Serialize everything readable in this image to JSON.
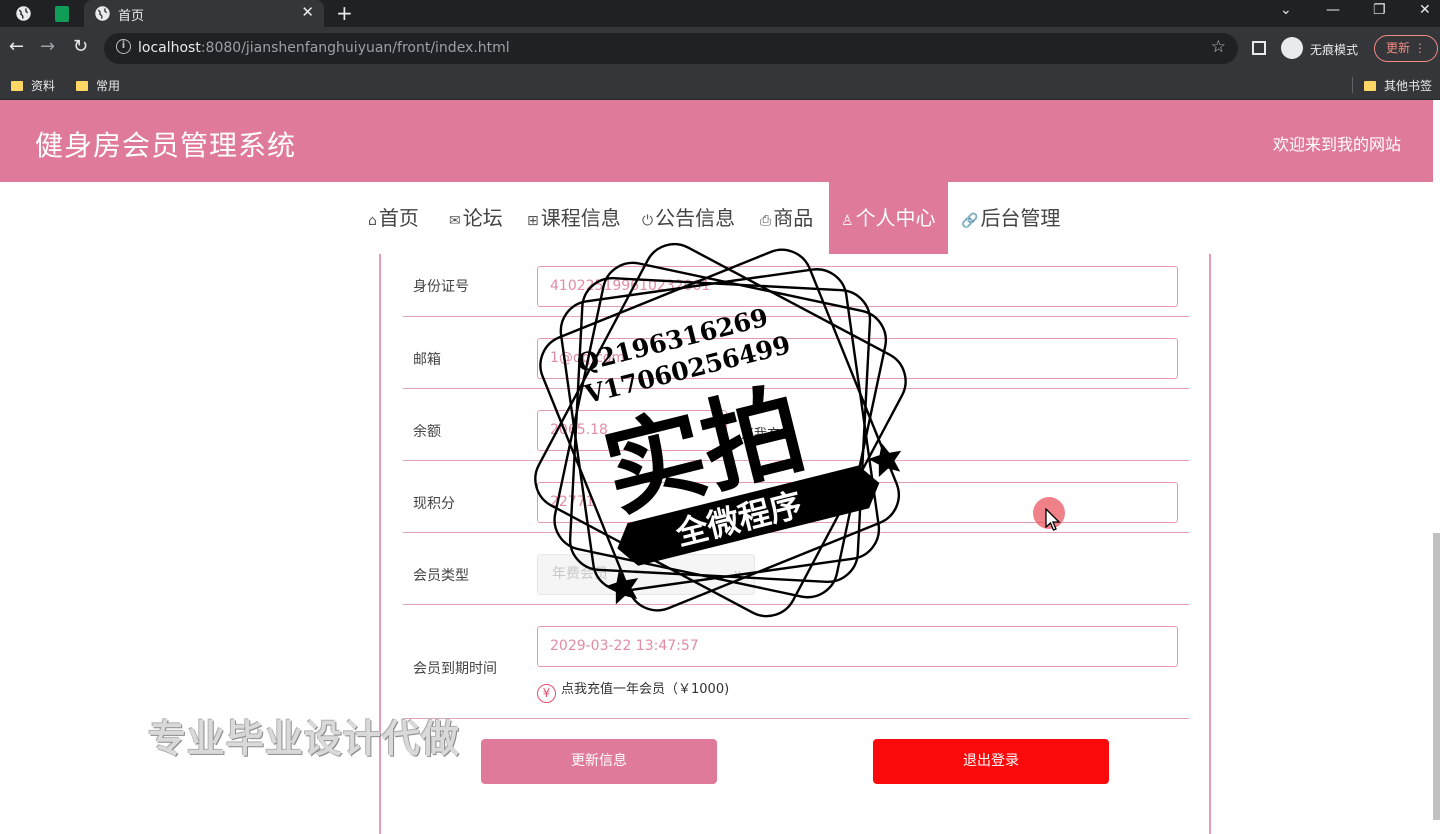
{
  "browser": {
    "tab_title": "首页",
    "url_host": "localhost",
    "url_rest": ":8080/jianshenfanghuiyuan/front/index.html",
    "incognito_label": "无痕模式",
    "update_label": "更新",
    "bookmarks": [
      "资料",
      "常用"
    ],
    "other_bookmarks": "其他书签"
  },
  "site": {
    "title": "健身房会员管理系统",
    "welcome": "欢迎来到我的网站",
    "accent_color": "#e07a9a"
  },
  "nav": {
    "items": [
      {
        "label": "首页",
        "icon": "home-icon"
      },
      {
        "label": "论坛",
        "icon": "mail-icon"
      },
      {
        "label": "课程信息",
        "icon": "gift-icon"
      },
      {
        "label": "公告信息",
        "icon": "power-icon"
      },
      {
        "label": "商品",
        "icon": "printer-icon"
      },
      {
        "label": "个人中心",
        "icon": "user-icon",
        "active": true
      },
      {
        "label": "后台管理",
        "icon": "link-icon"
      }
    ]
  },
  "form": {
    "id_card": {
      "label": "身份证号",
      "value": "410225199610232001"
    },
    "email": {
      "label": "邮箱",
      "value": "1@qq.com"
    },
    "balance": {
      "label": "余额",
      "value": "2065.18",
      "link": "点我充值"
    },
    "points": {
      "label": "现积分",
      "value": "22771"
    },
    "member_type": {
      "label": "会员类型",
      "value": "年费会员"
    },
    "expire": {
      "label": "会员到期时间",
      "value": "2029-03-22 13:47:57",
      "recharge_text": "点我充值一年会员（￥1000)"
    },
    "update_button": "更新信息",
    "logout_button": "退出登录",
    "logout_color": "#fa0a0a"
  },
  "watermark": {
    "stamp_line1": "Q2196316269",
    "stamp_line2": "V17060256499",
    "stamp_main": "实拍",
    "stamp_banner": "全微程序",
    "bottom_text": "专业毕业设计代做"
  }
}
